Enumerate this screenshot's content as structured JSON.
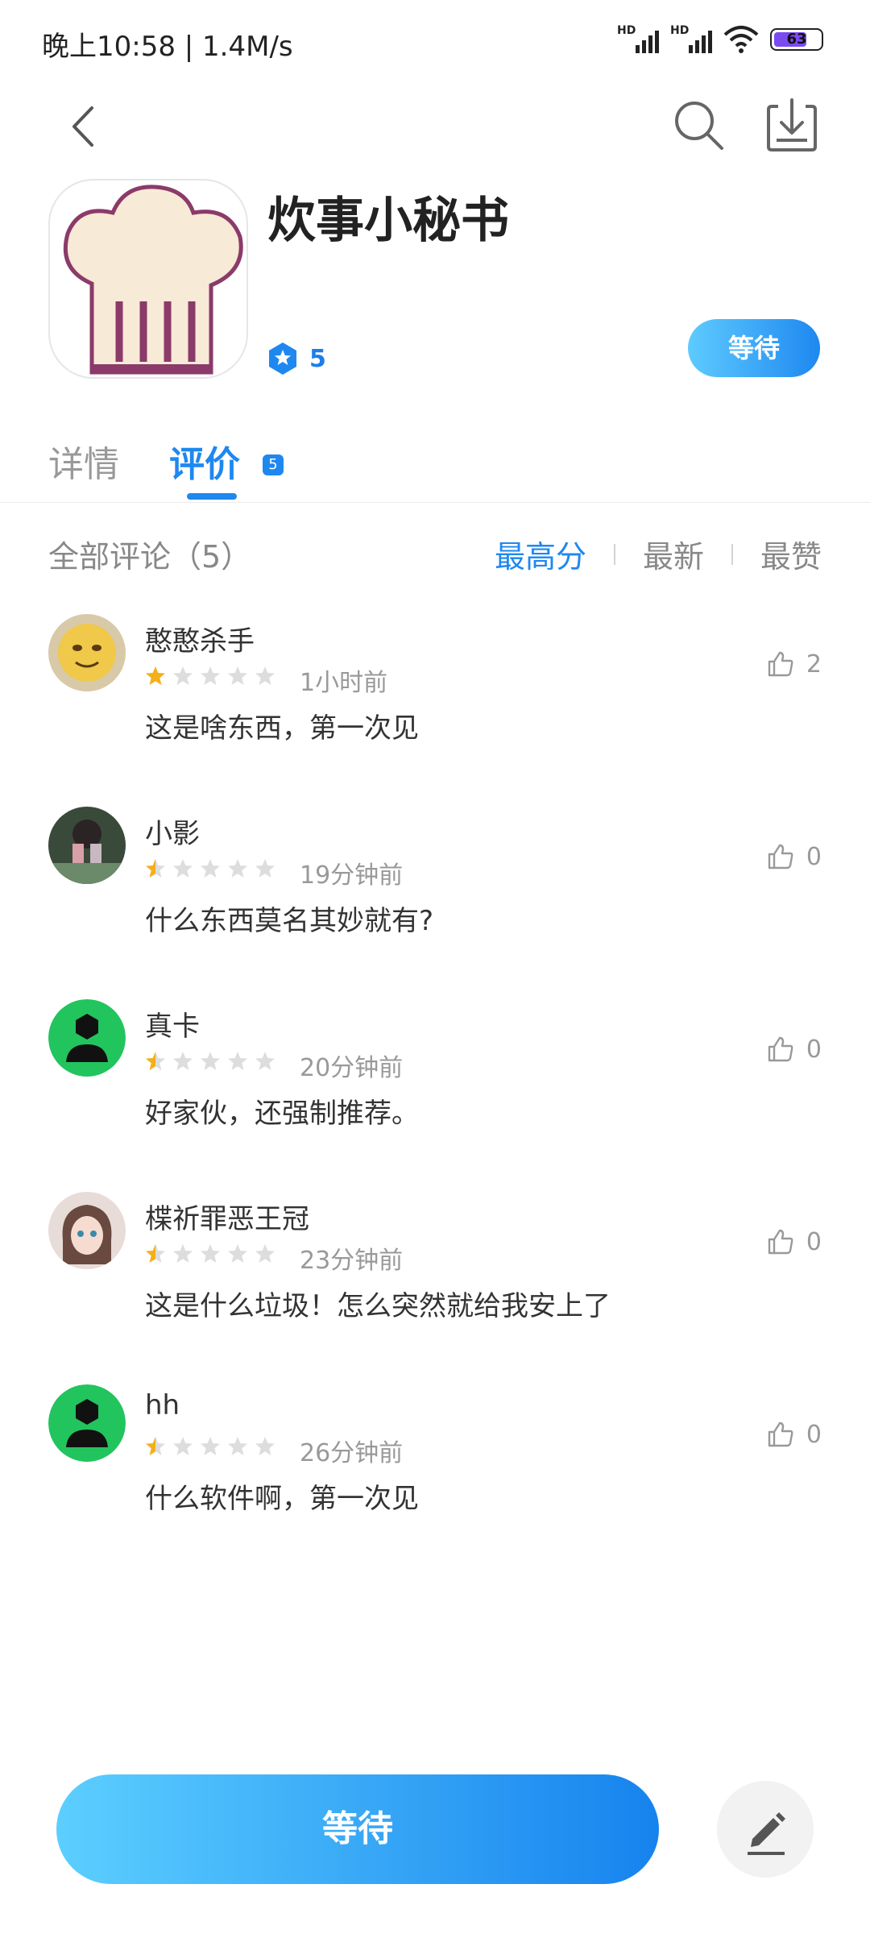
{
  "status": {
    "time_speed": "晚上10:58 | 1.4M/s",
    "battery": "63",
    "signal_label": "HD"
  },
  "header": {
    "back_icon": "back-arrow-icon",
    "search_icon": "search-icon",
    "download_icon": "download-icon"
  },
  "app": {
    "name": "炊事小秘书",
    "rating": "5",
    "wait_label": "等待"
  },
  "tabs": [
    {
      "label": "详情"
    },
    {
      "label": "评价",
      "badge": "5"
    }
  ],
  "filter": {
    "all_label": "全部评论（5）",
    "sorts": [
      "最高分",
      "最新",
      "最赞"
    ]
  },
  "reviews": [
    {
      "name": "憨憨杀手",
      "rating": 1.0,
      "time": "1小时前",
      "text": "这是啥东西，第一次见",
      "likes": "2"
    },
    {
      "name": "小影",
      "rating": 0.5,
      "time": "19分钟前",
      "text": "什么东西莫名其妙就有?",
      "likes": "0"
    },
    {
      "name": "真卡",
      "rating": 0.5,
      "time": "20分钟前",
      "text": "好家伙，还强制推荐。",
      "likes": "0"
    },
    {
      "name": "楪祈罪恶王冠",
      "rating": 0.5,
      "time": "23分钟前",
      "text": "这是什么垃圾！怎么突然就给我安上了",
      "likes": "0"
    },
    {
      "name": "hh",
      "rating": 0.5,
      "time": "26分钟前",
      "text": "什么软件啊，第一次见",
      "likes": "0"
    }
  ],
  "bottom": {
    "wait_label": "等待",
    "edit_icon": "edit-pen-icon"
  },
  "colors": {
    "accent": "#1e88f0",
    "star": "#f5b018",
    "star_empty": "#dddddd",
    "default_avatar": "#22c45e"
  }
}
